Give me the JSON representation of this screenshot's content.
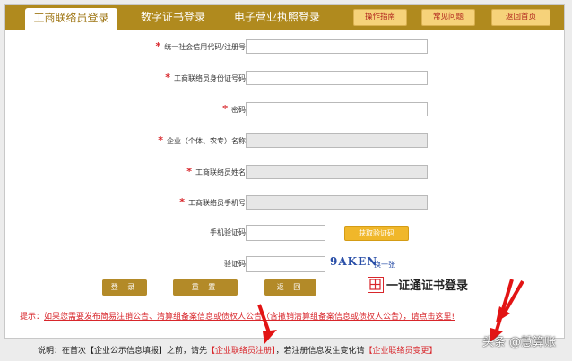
{
  "tabs": [
    {
      "label": "工商联络员登录",
      "active": true
    },
    {
      "label": "数字证书登录",
      "active": false
    },
    {
      "label": "电子营业执照登录",
      "active": false
    }
  ],
  "top_buttons": [
    "操作指南",
    "常见问题",
    "返回首页"
  ],
  "form": {
    "fields": [
      {
        "label": "统一社会信用代码/注册号",
        "required": true,
        "readonly": false,
        "value": ""
      },
      {
        "label": "工商联络员身份证号码",
        "required": true,
        "readonly": false,
        "value": ""
      },
      {
        "label": "密码",
        "required": true,
        "readonly": false,
        "value": ""
      },
      {
        "label": "企业（个体、农专）名称",
        "required": true,
        "readonly": true,
        "value": ""
      },
      {
        "label": "工商联络员姓名",
        "required": true,
        "readonly": true,
        "value": ""
      },
      {
        "label": "工商联络员手机号",
        "required": true,
        "readonly": true,
        "value": ""
      }
    ],
    "sms_label": "手机验证码",
    "sms_button": "获取验证码",
    "captcha_label": "验证码",
    "captcha_text": "9AKEN",
    "refresh_label": "换一张"
  },
  "actions": {
    "login": "登 录",
    "reset": "重 置",
    "back": "返 回"
  },
  "cert_login": "一证通证书登录",
  "tip": {
    "prefix": "提示：",
    "link": "如果您需要发布简易注销公告、清算组备案信息或债权人公告（含撤销清算组备案信息或债权人公告），请点击这里!"
  },
  "note": {
    "p1": "说明：在首次【企业公示信息填报】之前，请先",
    "link1": "【企业联络员注册】",
    "p2": "，若注册信息发生变化请",
    "link2": "【企业联络员变更】"
  },
  "watermark": "头条 @慧算账",
  "colors": {
    "tabbar": "#b08a1e",
    "accent_red": "#d8262b",
    "gold_button": "#b38a28"
  }
}
